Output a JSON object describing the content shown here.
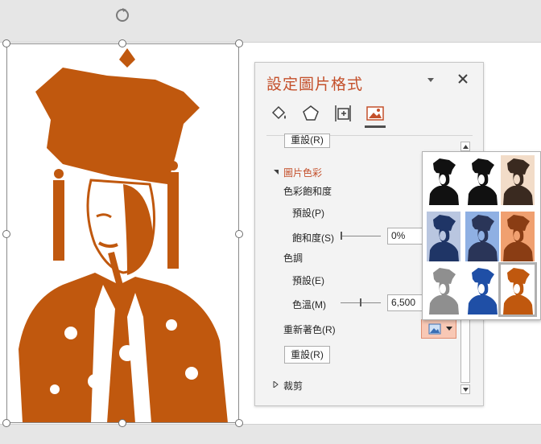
{
  "pane": {
    "title": "設定圖片格式",
    "top_reset_label": "重設(R)",
    "section_picture_color": "圖片色彩",
    "saturation_group": "色彩飽和度",
    "saturation_presets": "預設(P)",
    "saturation_label": "飽和度(S)",
    "saturation_value": "0%",
    "tone_group": "色調",
    "tone_presets": "預設(E)",
    "temperature_label": "色溫(M)",
    "temperature_value": "6,500",
    "recolor_label": "重新著色(R)",
    "reset_label": "重設(R)",
    "crop_section": "裁剪"
  },
  "icons": {
    "fill_line": "paint-bucket-icon",
    "effects": "pentagon-icon",
    "size_properties": "size-position-icon",
    "picture": "picture-icon"
  },
  "recolor_gallery": {
    "colors": [
      "#111111",
      "#111111",
      "#3a2a20",
      "#1f3566",
      "#2a3558",
      "#8a3d14",
      "#8f8f8f",
      "#1f4fa6",
      "#c0580e"
    ],
    "backgrounds": [
      "#ffffff",
      "#ffffff",
      "#f2dcc8",
      "#b9c6e0",
      "#8fb0e3",
      "#f0a070",
      "#ffffff",
      "#ffffff",
      "#ffffff"
    ],
    "selected_index": 8
  },
  "colors": {
    "accent": "#c4502b",
    "picture_tint": "#c0580e"
  }
}
